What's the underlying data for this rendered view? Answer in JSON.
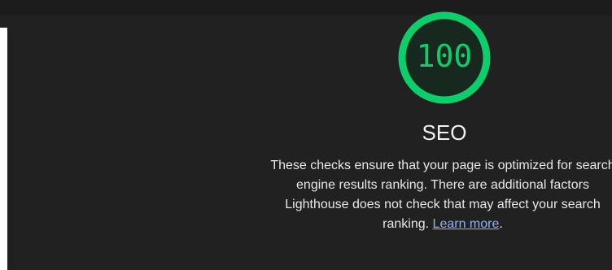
{
  "gauge": {
    "score": "100",
    "fill_fraction": 1.0,
    "color": "#0cce6b",
    "fill_color": "#17281e"
  },
  "category": {
    "title": "SEO",
    "description": "These checks ensure that your page is optimized for search engine results ranking. There are additional factors Lighthouse does not check that may affect your search ranking.",
    "link_text": "Learn more",
    "trailing": "."
  },
  "colors": {
    "background": "#212121",
    "text": "#f1f1f1",
    "link": "#8ab4f8"
  }
}
